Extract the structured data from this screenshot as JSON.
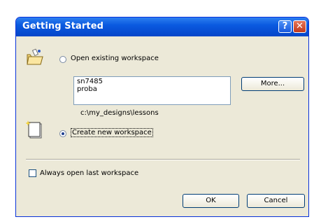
{
  "dialog": {
    "title": "Getting Started",
    "help_glyph": "?",
    "close_glyph": "✕"
  },
  "open_existing": {
    "label": "Open existing workspace",
    "selected": false,
    "workspaces": [
      "sn7485",
      "proba"
    ],
    "more_button": "More...",
    "path": "c:\\my_designs\\lessons"
  },
  "create_new": {
    "label": "Create new workspace",
    "selected": true
  },
  "always_open_last": {
    "label": "Always open last workspace",
    "checked": false
  },
  "buttons": {
    "ok": "OK",
    "cancel": "Cancel"
  },
  "icons": {
    "open": "open-folder-icon",
    "create": "new-document-icon"
  },
  "colors": {
    "titlebar": "#0a5ae0",
    "dialog_bg": "#ece9d8",
    "close_button": "#c1381b"
  }
}
